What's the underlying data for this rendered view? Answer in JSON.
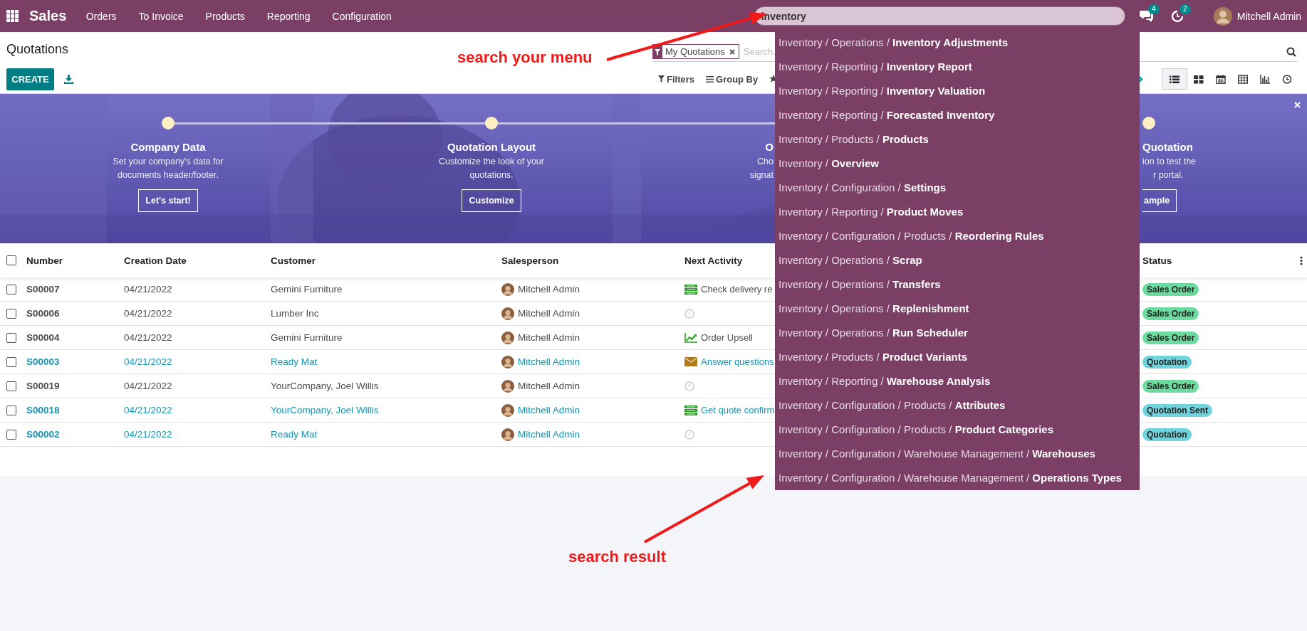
{
  "app": {
    "name": "Sales",
    "menu": [
      "Orders",
      "To Invoice",
      "Products",
      "Reporting",
      "Configuration"
    ]
  },
  "menu_search": {
    "value": "inventory",
    "results": [
      "Inventory / Operations / **Inventory Adjustments**",
      "Inventory / Reporting / **Inventory Report**",
      "Inventory / Reporting / **Inventory Valuation**",
      "Inventory / Reporting / **Forecasted Inventory**",
      "Inventory / Products / **Products**",
      "Inventory / **Overview**",
      "Inventory / Configuration / **Settings**",
      "Inventory / Reporting / **Product Moves**",
      "Inventory / Configuration / Products / **Reordering Rules**",
      "Inventory / Operations / **Scrap**",
      "Inventory / Operations / **Transfers**",
      "Inventory / Operations / **Replenishment**",
      "Inventory / Operations / **Run Scheduler**",
      "Inventory / Products / **Product Variants**",
      "Inventory / Reporting / **Warehouse Analysis**",
      "Inventory / Configuration / Products / **Attributes**",
      "Inventory / Configuration / Products / **Product Categories**",
      "Inventory / Configuration / Warehouse Management / **Warehouses**",
      "Inventory / Configuration / Warehouse Management / **Operations Types**"
    ]
  },
  "systray": {
    "messages_count": "4",
    "activities_count": "2",
    "user": "Mitchell Admin"
  },
  "control_panel": {
    "title": "Quotations",
    "create_button": "CREATE",
    "facet": "My Quotations",
    "search_placeholder": "Search.",
    "filters": "Filters",
    "group_by": "Group By",
    "views": [
      {
        "kind": "list",
        "selected": true
      },
      {
        "kind": "kanban",
        "selected": false
      },
      {
        "kind": "calendar",
        "selected": false
      },
      {
        "kind": "pivot",
        "selected": false
      },
      {
        "kind": "graph",
        "selected": false
      },
      {
        "kind": "activity",
        "selected": false
      }
    ]
  },
  "banner": {
    "steps": [
      {
        "kind": "whole",
        "title": "Company Data",
        "lines": [
          "Set your company's data for",
          "documents header/footer."
        ],
        "button": "Let's start!"
      },
      {
        "kind": "whole",
        "title": "Quotation Layout",
        "lines": [
          "Customize the look of your",
          "quotations."
        ],
        "button": "Customize"
      },
      {
        "kind": "cut_at_right",
        "title": "O",
        "lines": [
          "Cho",
          "signat"
        ]
      },
      {
        "kind": "cut_at_left",
        "title": "Quotation",
        "lines": [
          "ion to test the",
          "r portal."
        ],
        "button": "ample"
      }
    ]
  },
  "table": {
    "select_all_checked": false,
    "columns": [
      "Number",
      "Creation Date",
      "Customer",
      "Salesperson",
      "Next Activity",
      "Status"
    ],
    "rows": [
      {
        "checked": false,
        "emphasized": false,
        "number": "S00007",
        "date": "04/21/2022",
        "customer": "Gemini Furniture",
        "salesperson": "Mitchell Admin",
        "activity": {
          "kind": "task",
          "text": "Check delivery re"
        },
        "status": {
          "label": "Sales Order",
          "color": "#6cdc9e"
        }
      },
      {
        "checked": false,
        "emphasized": false,
        "number": "S00006",
        "date": "04/21/2022",
        "customer": "Lumber Inc",
        "salesperson": "Mitchell Admin",
        "activity": {
          "kind": "none"
        },
        "status": {
          "label": "Sales Order",
          "color": "#6cdc9e"
        }
      },
      {
        "checked": false,
        "emphasized": false,
        "number": "S00004",
        "date": "04/21/2022",
        "customer": "Gemini Furniture",
        "salesperson": "Mitchell Admin",
        "activity": {
          "kind": "upsell",
          "text": "Order Upsell"
        },
        "status": {
          "label": "Sales Order",
          "color": "#6cdc9e"
        }
      },
      {
        "checked": false,
        "emphasized": true,
        "number": "S00003",
        "date": "04/21/2022",
        "customer": "Ready Mat",
        "salesperson": "Mitchell Admin",
        "activity": {
          "kind": "email",
          "text": "Answer questions"
        },
        "status": {
          "label": "Quotation",
          "color": "#6ed3dc"
        }
      },
      {
        "checked": false,
        "emphasized": false,
        "number": "S00019",
        "date": "04/21/2022",
        "customer": "YourCompany, Joel Willis",
        "salesperson": "Mitchell Admin",
        "activity": {
          "kind": "none"
        },
        "status": {
          "label": "Sales Order",
          "color": "#6cdc9e"
        }
      },
      {
        "checked": false,
        "emphasized": true,
        "number": "S00018",
        "date": "04/21/2022",
        "customer": "YourCompany, Joel Willis",
        "salesperson": "Mitchell Admin",
        "activity": {
          "kind": "task",
          "text": "Get quote confirm"
        },
        "status": {
          "label": "Quotation Sent",
          "color": "#6ed3dc"
        }
      },
      {
        "checked": false,
        "emphasized": true,
        "number": "S00002",
        "date": "04/21/2022",
        "customer": "Ready Mat",
        "salesperson": "Mitchell Admin",
        "activity": {
          "kind": "none"
        },
        "status": {
          "label": "Quotation",
          "color": "#6ed3dc"
        }
      }
    ]
  },
  "annotations": [
    {
      "text": "search your menu"
    },
    {
      "text": "search result"
    }
  ]
}
